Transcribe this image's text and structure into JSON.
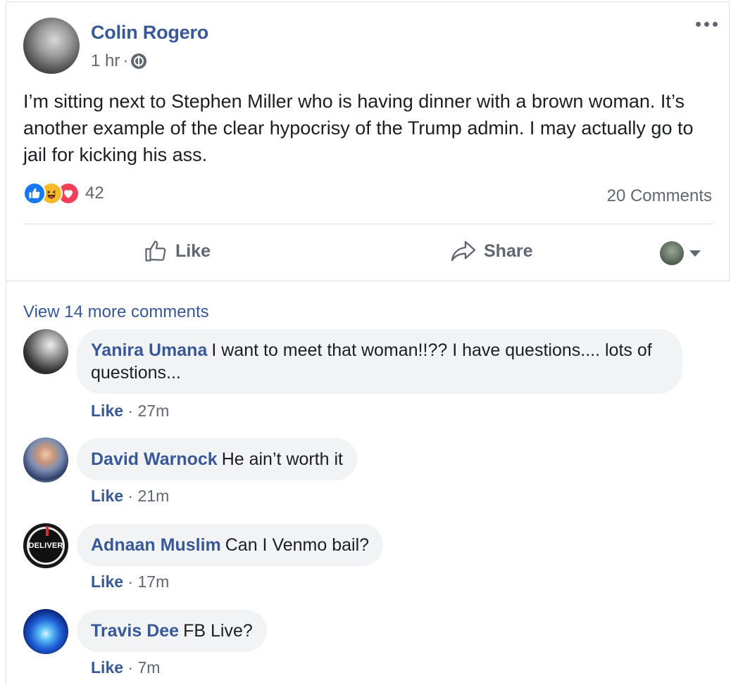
{
  "post": {
    "author": "Colin Rogero",
    "time": "1 hr",
    "dot": "·",
    "text": "I’m sitting next to Stephen Miller who is having dinner with a brown woman. It’s another example of the clear hypocrisy of the Trump admin. I may actually go to jail for kicking his ass.",
    "reaction_count": "42",
    "comments_count": "20 Comments",
    "reactions": [
      "like",
      "haha",
      "love"
    ]
  },
  "actions": {
    "like_label": "Like",
    "share_label": "Share"
  },
  "comments_section": {
    "view_more": "View 14 more comments",
    "comments": [
      {
        "name": "Yanira Umana",
        "text": "I want to meet that woman!!?? I have questions.... lots of questions...",
        "like": "Like",
        "time": "27m"
      },
      {
        "name": "David Warnock",
        "text": "He ain’t worth it",
        "like": "Like",
        "time": "21m"
      },
      {
        "name": "Adnaan Muslim",
        "text": "Can I Venmo bail?",
        "like": "Like",
        "time": "17m",
        "avatar_text": "DELIVER"
      },
      {
        "name": "Travis Dee",
        "text": "FB Live?",
        "like": "Like",
        "time": "7m"
      }
    ]
  },
  "colors": {
    "link": "#385898",
    "secondary_text": "#606770",
    "bubble": "#f2f3f5",
    "like_reaction": "#1877f2",
    "haha_reaction": "#f7b928",
    "love_reaction": "#f33e58"
  }
}
